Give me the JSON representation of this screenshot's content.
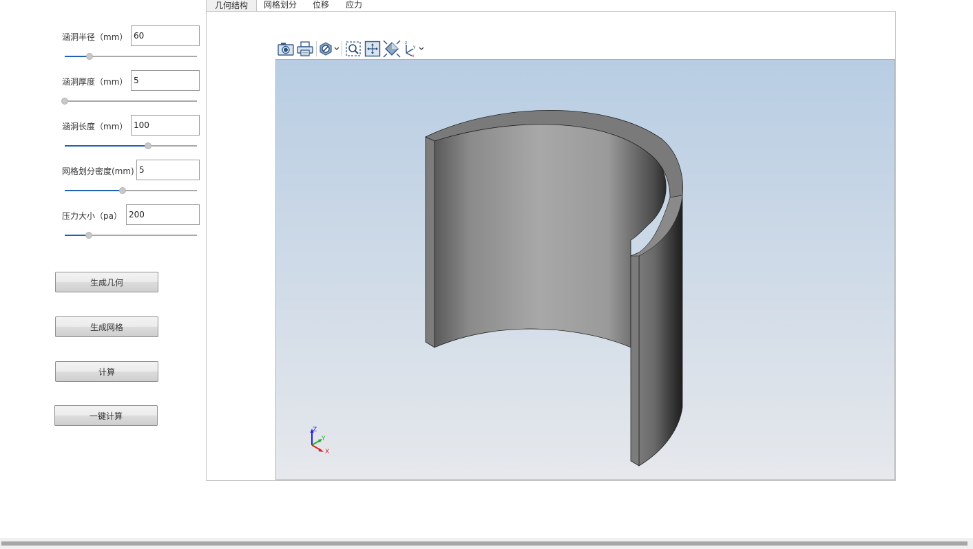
{
  "tabs": [
    "几何结构",
    "网格划分",
    "位移",
    "应力"
  ],
  "params": [
    {
      "label": "涵洞半径（mm）",
      "value": "60",
      "slider_fraction": 0.19
    },
    {
      "label": "涵洞厚度（mm）",
      "value": "5",
      "slider_fraction": 0.0
    },
    {
      "label": "涵洞长度（mm）",
      "value": "100",
      "slider_fraction": 0.63
    },
    {
      "label": "网格划分密度(mm)",
      "value": "5",
      "slider_fraction": 0.44
    },
    {
      "label": "压力大小（pa）",
      "value": "200",
      "slider_fraction": 0.18
    }
  ],
  "buttons": [
    "生成几何",
    "生成网格",
    "计算",
    "一键计算"
  ],
  "toolbar": {
    "icons": [
      "camera-icon",
      "print-icon",
      "display-mode-icon",
      "zoom-box-icon",
      "fit-view-icon",
      "view-fit-all-icon",
      "axis-orientation-icon"
    ]
  },
  "viewport": {
    "triad_labels": {
      "x": "X",
      "y": "Y",
      "z": "Z"
    },
    "colors": {
      "bg_top": "#b8cde3",
      "bg_bottom": "#e6e8ec",
      "x_axis": "#e02020",
      "y_axis": "#20b020",
      "z_axis": "#2020e0"
    }
  },
  "colors": {
    "accent": "#1f63b0"
  }
}
